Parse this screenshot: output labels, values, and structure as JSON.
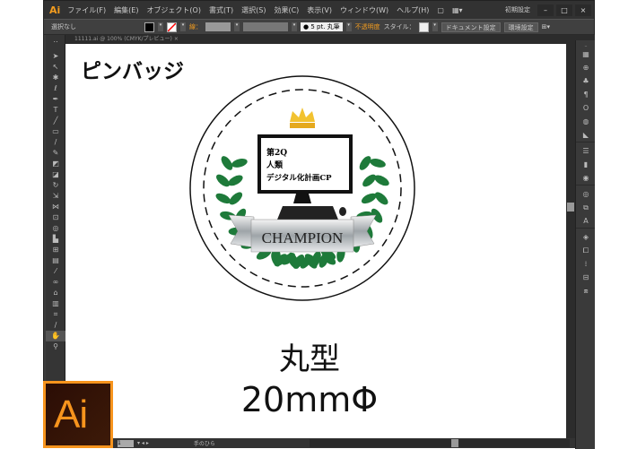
{
  "app": {
    "logo": "Ai",
    "workspace": "初期設定",
    "window_buttons": [
      "–",
      "□",
      "×"
    ]
  },
  "menu": [
    "ファイル(F)",
    "編集(E)",
    "オブジェクト(O)",
    "書式(T)",
    "選択(S)",
    "効果(C)",
    "表示(V)",
    "ウィンドウ(W)",
    "ヘルプ(H)"
  ],
  "control_bar": {
    "selection": "選択なし",
    "stroke_label": "線：",
    "brush": "5 pt. 丸筆",
    "opacity_label": "不透明度",
    "style_label": "スタイル：",
    "document_setup": "ドキュメント設定",
    "preferences": "環境設定"
  },
  "document_tab": "11111.ai @ 100% (CMYK/プレビュー)",
  "tab_close": "×",
  "artboard": {
    "title": "ピンバッジ",
    "badge": {
      "screen_lines": [
        "第2Q",
        "人類",
        "デジタル化計画CP"
      ],
      "ribbon": "CHAMPION"
    },
    "shape": "丸型",
    "size": "20mmΦ"
  },
  "status_bar": {
    "zoom": "1",
    "tool": "手のひら"
  },
  "colors": {
    "accent": "#f7941d",
    "laurel": "#1e7a3a",
    "crown": "#f2c230"
  }
}
